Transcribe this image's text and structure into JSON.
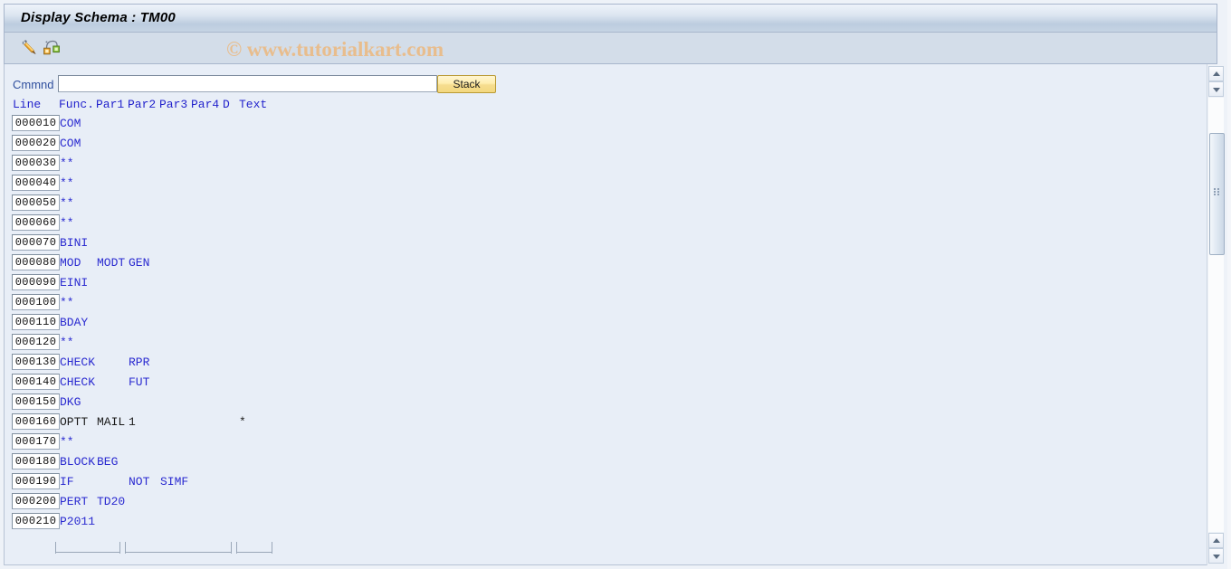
{
  "window": {
    "title": "Display Schema : TM00"
  },
  "toolbar": {
    "buttons": [
      {
        "name": "edit-pencil-icon",
        "label": "Change"
      },
      {
        "name": "structure-icon",
        "label": "Structure"
      }
    ]
  },
  "watermark": {
    "text": "© www.tutorialkart.com",
    "color": "#e8bd8d"
  },
  "command_bar": {
    "label": "Cmmnd",
    "input_value": "",
    "input_placeholder": "",
    "stack_button": "Stack"
  },
  "table": {
    "headers": {
      "line": "Line",
      "func": "Func.",
      "par1": "Par1",
      "par2": "Par2",
      "par3": "Par3",
      "par4": "Par4",
      "d": "D",
      "text": "Text"
    },
    "rows": [
      {
        "line": "000010",
        "func": "COM",
        "par1": "",
        "par2": "",
        "par3": "",
        "par4": "",
        "d": "",
        "text": "",
        "color": "blue"
      },
      {
        "line": "000020",
        "func": "COM",
        "par1": "",
        "par2": "",
        "par3": "",
        "par4": "",
        "d": "",
        "text": "",
        "color": "blue"
      },
      {
        "line": "000030",
        "func": "**",
        "par1": "",
        "par2": "",
        "par3": "",
        "par4": "",
        "d": "",
        "text": "",
        "color": "blue"
      },
      {
        "line": "000040",
        "func": "**",
        "par1": "",
        "par2": "",
        "par3": "",
        "par4": "",
        "d": "",
        "text": "",
        "color": "blue"
      },
      {
        "line": "000050",
        "func": "**",
        "par1": "",
        "par2": "",
        "par3": "",
        "par4": "",
        "d": "",
        "text": "",
        "color": "blue"
      },
      {
        "line": "000060",
        "func": "**",
        "par1": "",
        "par2": "",
        "par3": "",
        "par4": "",
        "d": "",
        "text": "",
        "color": "blue"
      },
      {
        "line": "000070",
        "func": "BINI",
        "par1": "",
        "par2": "",
        "par3": "",
        "par4": "",
        "d": "",
        "text": "",
        "color": "blue"
      },
      {
        "line": "000080",
        "func": "MOD",
        "par1": "MODT",
        "par2": "GEN",
        "par3": "",
        "par4": "",
        "d": "",
        "text": "",
        "color": "blue"
      },
      {
        "line": "000090",
        "func": "EINI",
        "par1": "",
        "par2": "",
        "par3": "",
        "par4": "",
        "d": "",
        "text": "",
        "color": "blue"
      },
      {
        "line": "000100",
        "func": "**",
        "par1": "",
        "par2": "",
        "par3": "",
        "par4": "",
        "d": "",
        "text": "",
        "color": "blue"
      },
      {
        "line": "000110",
        "func": "BDAY",
        "par1": "",
        "par2": "",
        "par3": "",
        "par4": "",
        "d": "",
        "text": "",
        "color": "blue"
      },
      {
        "line": "000120",
        "func": "**",
        "par1": "",
        "par2": "",
        "par3": "",
        "par4": "",
        "d": "",
        "text": "",
        "color": "blue"
      },
      {
        "line": "000130",
        "func": "CHECK",
        "par1": "",
        "par2": "RPR",
        "par3": "",
        "par4": "",
        "d": "",
        "text": "",
        "color": "blue"
      },
      {
        "line": "000140",
        "func": "CHECK",
        "par1": "",
        "par2": "FUT",
        "par3": "",
        "par4": "",
        "d": "",
        "text": "",
        "color": "blue"
      },
      {
        "line": "000150",
        "func": "DKG",
        "par1": "",
        "par2": "",
        "par3": "",
        "par4": "",
        "d": "",
        "text": "",
        "color": "blue"
      },
      {
        "line": "000160",
        "func": "OPTT",
        "par1": "MAIL",
        "par2": "1",
        "par3": "",
        "par4": "",
        "d": "",
        "text": "*",
        "color": "black"
      },
      {
        "line": "000170",
        "func": "**",
        "par1": "",
        "par2": "",
        "par3": "",
        "par4": "",
        "d": "",
        "text": "",
        "color": "blue"
      },
      {
        "line": "000180",
        "func": "BLOCK",
        "par1": "BEG",
        "par2": "",
        "par3": "",
        "par4": "",
        "d": "",
        "text": "",
        "color": "blue"
      },
      {
        "line": "000190",
        "func": "IF",
        "par1": "",
        "par2": "NOT",
        "par3": "SIMF",
        "par4": "",
        "d": "",
        "text": "",
        "color": "blue"
      },
      {
        "line": "000200",
        "func": "PERT",
        "par1": "TD20",
        "par2": "",
        "par3": "",
        "par4": "",
        "d": "",
        "text": "",
        "color": "blue"
      },
      {
        "line": "000210",
        "func": "P2011",
        "par1": "",
        "par2": "",
        "par3": "",
        "par4": "",
        "d": "",
        "text": "",
        "color": "blue"
      }
    ]
  },
  "scrollbar": {
    "up_label": "Scroll up",
    "down_label": "Scroll down"
  }
}
